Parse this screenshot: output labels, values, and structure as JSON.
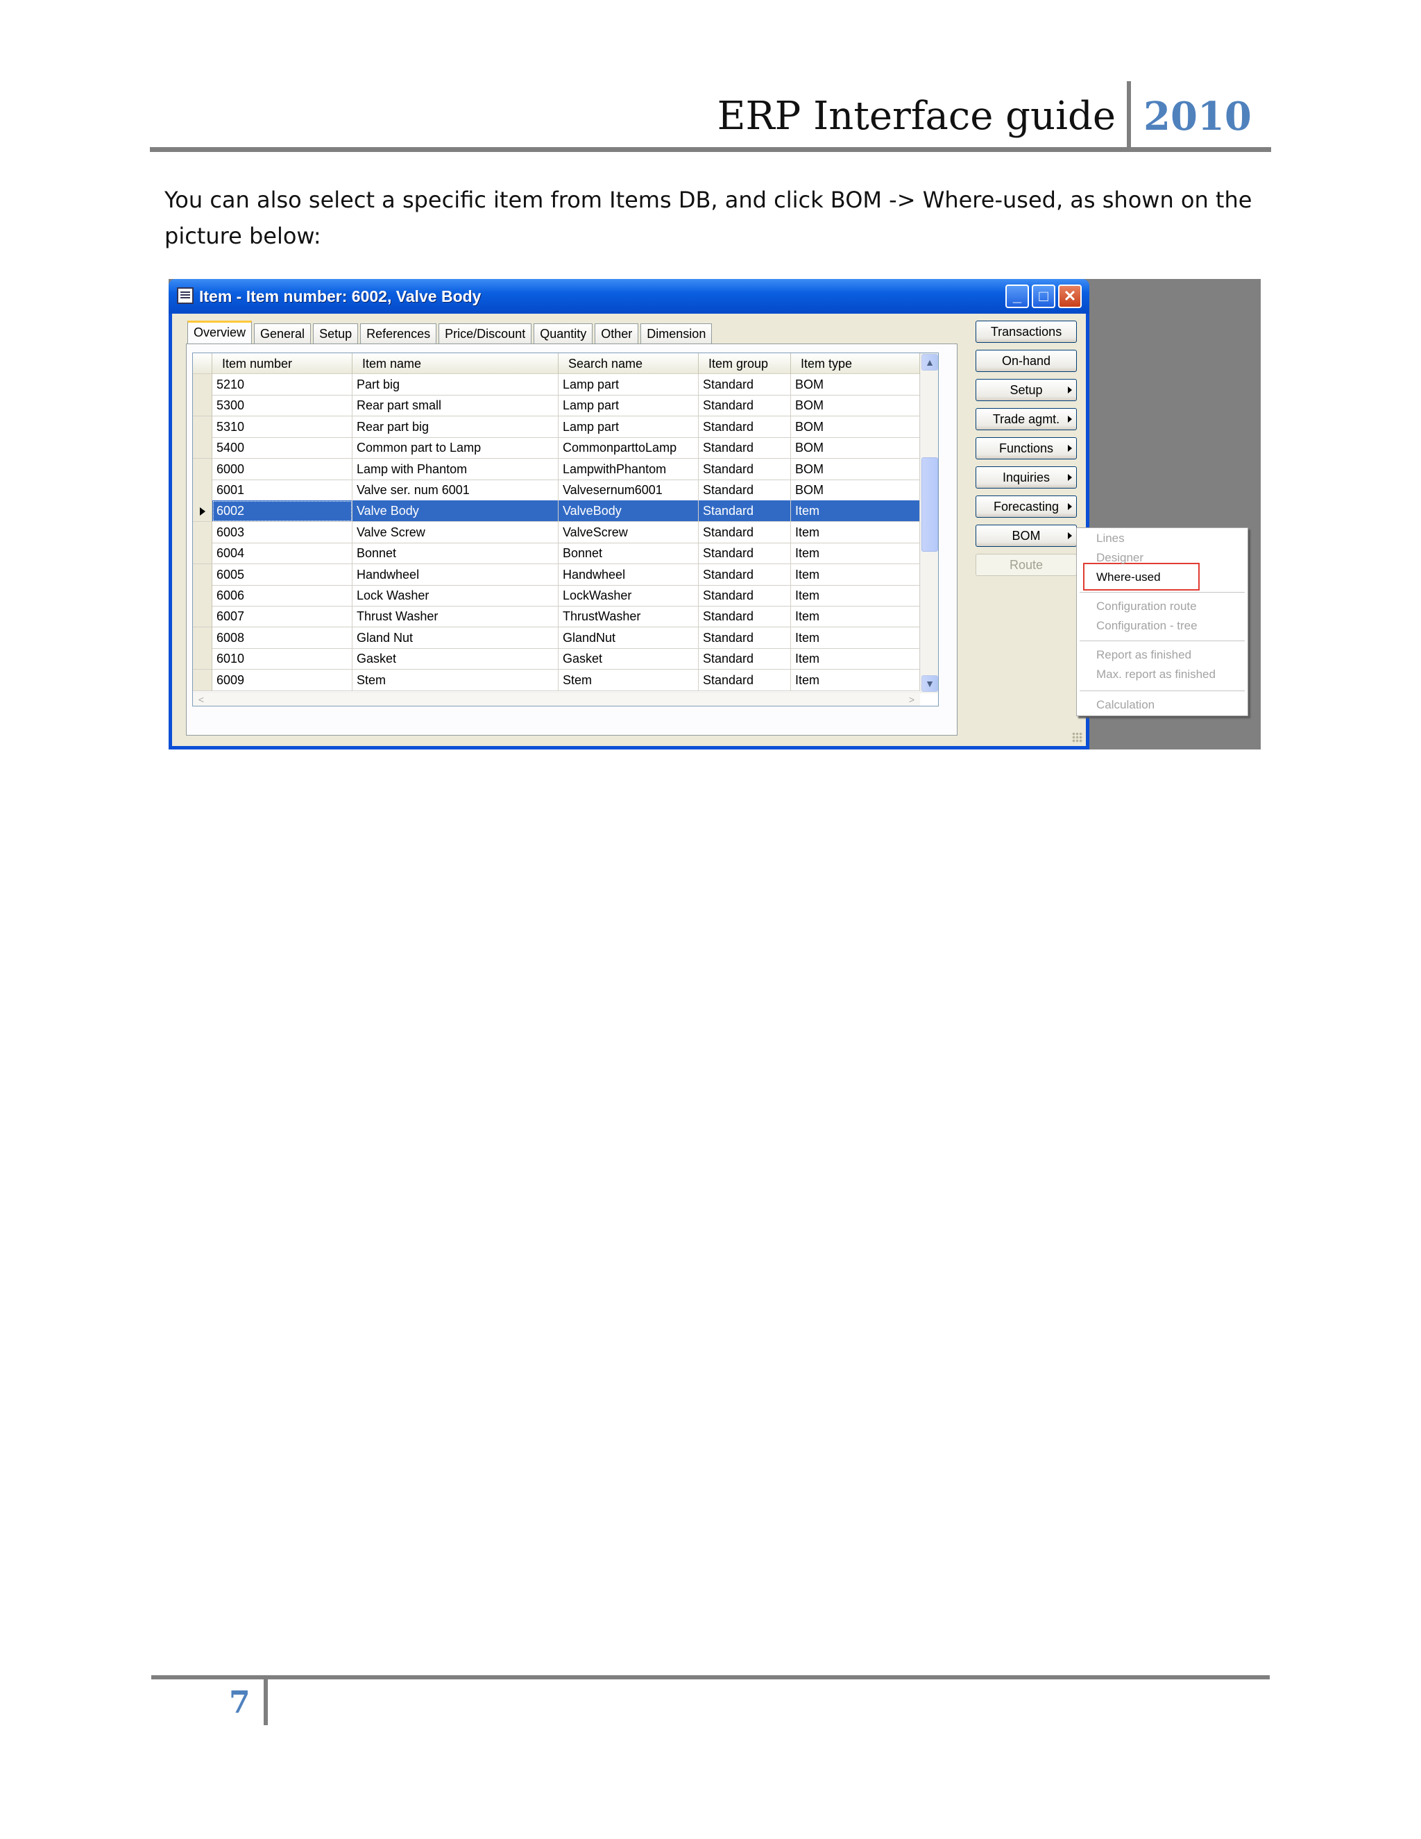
{
  "doc_header": {
    "title": "ERP Interface guide",
    "year": "2010"
  },
  "intro_text": "You can also select a specific item from Items DB, and click BOM -> Where-used, as shown on the picture below:",
  "page_number": "7",
  "window": {
    "title": "Item - Item number: 6002, Valve Body",
    "minimize_glyph": "_",
    "maximize_glyph": "□",
    "close_glyph": "✕",
    "tabs": [
      "Overview",
      "General",
      "Setup",
      "References",
      "Price/Discount",
      "Quantity",
      "Other",
      "Dimension"
    ],
    "active_tab": "Overview"
  },
  "grid": {
    "columns": [
      "Item number",
      "Item name",
      "Search name",
      "Item group",
      "Item type"
    ],
    "rows": [
      [
        "5210",
        "Part big",
        "Lamp part",
        "Standard",
        "BOM"
      ],
      [
        "5300",
        "Rear part small",
        "Lamp part",
        "Standard",
        "BOM"
      ],
      [
        "5310",
        "Rear part big",
        "Lamp part",
        "Standard",
        "BOM"
      ],
      [
        "5400",
        "Common part to Lamp",
        "CommonparttoLamp",
        "Standard",
        "BOM"
      ],
      [
        "6000",
        "Lamp with Phantom",
        "LampwithPhantom",
        "Standard",
        "BOM"
      ],
      [
        "6001",
        "Valve ser. num 6001",
        "Valvesernum6001",
        "Standard",
        "BOM"
      ],
      [
        "6002",
        "Valve Body",
        "ValveBody",
        "Standard",
        "Item"
      ],
      [
        "6003",
        "Valve Screw",
        "ValveScrew",
        "Standard",
        "Item"
      ],
      [
        "6004",
        "Bonnet",
        "Bonnet",
        "Standard",
        "Item"
      ],
      [
        "6005",
        "Handwheel",
        "Handwheel",
        "Standard",
        "Item"
      ],
      [
        "6006",
        "Lock Washer",
        "LockWasher",
        "Standard",
        "Item"
      ],
      [
        "6007",
        "Thrust Washer",
        "ThrustWasher",
        "Standard",
        "Item"
      ],
      [
        "6008",
        "Gland Nut",
        "GlandNut",
        "Standard",
        "Item"
      ],
      [
        "6010",
        "Gasket",
        "Gasket",
        "Standard",
        "Item"
      ],
      [
        "6009",
        "Stem",
        "Stem",
        "Standard",
        "Item"
      ]
    ],
    "selected_item": "6002"
  },
  "side_buttons": [
    {
      "label": "Transactions",
      "submenu": false,
      "enabled": true
    },
    {
      "label": "On-hand",
      "submenu": false,
      "enabled": true
    },
    {
      "label": "Setup",
      "submenu": true,
      "enabled": true
    },
    {
      "label": "Trade agmt.",
      "submenu": true,
      "enabled": true
    },
    {
      "label": "Functions",
      "submenu": true,
      "enabled": true
    },
    {
      "label": "Inquiries",
      "submenu": true,
      "enabled": true
    },
    {
      "label": "Forecasting",
      "submenu": true,
      "enabled": true
    },
    {
      "label": "BOM",
      "submenu": true,
      "enabled": true
    },
    {
      "label": "Route",
      "submenu": false,
      "enabled": false
    }
  ],
  "bom_menu": {
    "groups": [
      [
        {
          "label": "Lines",
          "enabled": false
        },
        {
          "label": "Designer",
          "enabled": false
        },
        {
          "label": "Where-used",
          "enabled": true
        }
      ],
      [
        {
          "label": "Configuration route",
          "enabled": false
        },
        {
          "label": "Configuration - tree",
          "enabled": false
        }
      ],
      [
        {
          "label": "Report as finished",
          "enabled": false
        },
        {
          "label": "Max. report as finished",
          "enabled": false
        }
      ],
      [
        {
          "label": "Calculation",
          "enabled": false
        }
      ]
    ],
    "highlighted": "Where-used",
    "highlight_color": "#e03c31"
  },
  "colors": {
    "accent": "#4f81bd",
    "selection": "#316ac5",
    "titlebar": "#0a5fe0"
  }
}
